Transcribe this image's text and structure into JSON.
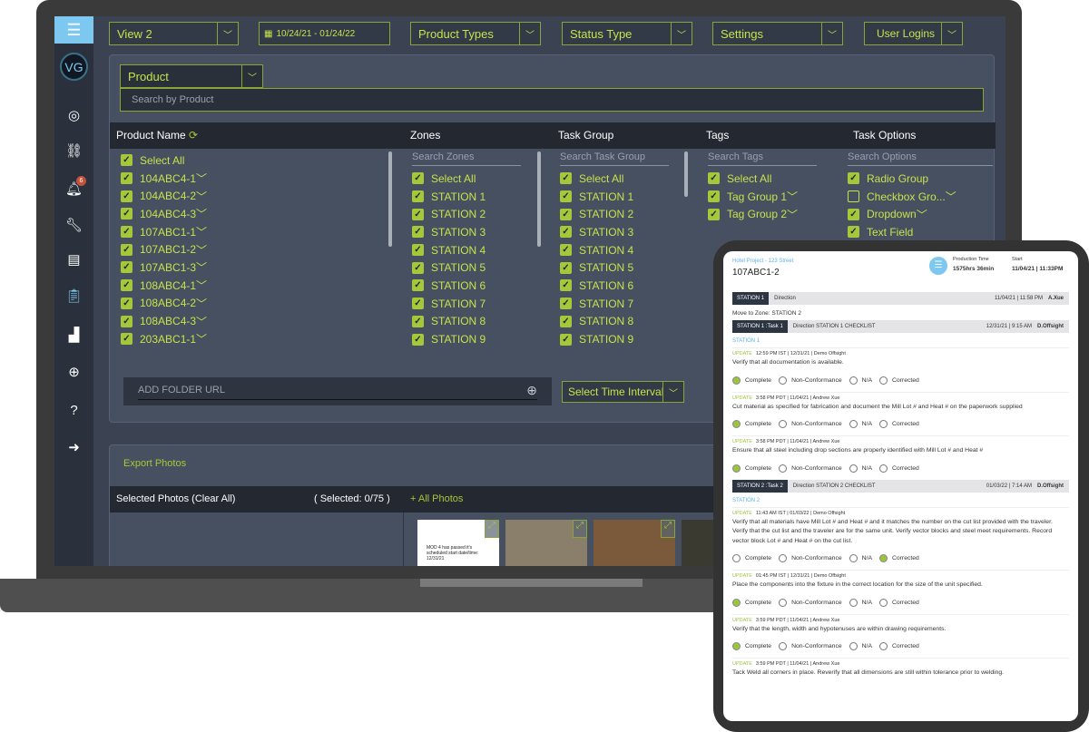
{
  "sidebar": {
    "logo_icon": "stack-logo-icon",
    "avatar": "VG",
    "notification_count": "6",
    "icons": [
      "target-icon",
      "broken-link-icon",
      "bell-icon",
      "wrench-icon",
      "list-icon",
      "clipboard-icon",
      "chart-icon",
      "grid-icon",
      "help-icon",
      "logout-icon"
    ]
  },
  "topbar": {
    "view": "View 2",
    "date_range": "10/24/21 - 01/24/22",
    "product_types": "Product Types",
    "status_type": "Status Type",
    "settings": "Settings",
    "user_logins": "User Logins"
  },
  "filter": {
    "product_dropdown": "Product",
    "search_placeholder": "Search by Product",
    "headers": {
      "product": "Product Name",
      "zones": "Zones",
      "task_group": "Task Group",
      "tags": "Tags",
      "task_options": "Task Options"
    },
    "search_zones": "Search Zones",
    "search_task_group": "Search Task Group",
    "search_tags": "Search Tags",
    "search_options": "Search Options",
    "products": [
      "Select All",
      "104ABC4-1",
      "104ABC4-2",
      "104ABC4-3",
      "107ABC1-1",
      "107ABC1-2",
      "107ABC1-3",
      "108ABC4-1",
      "108ABC4-2",
      "108ABC4-3",
      "203ABC1-1"
    ],
    "zones": [
      "Select All",
      "STATION 1",
      "STATION 2",
      "STATION 3",
      "STATION 4",
      "STATION 5",
      "STATION 6",
      "STATION 7",
      "STATION 8",
      "STATION 9"
    ],
    "task_groups": [
      "Select All",
      "STATION 1",
      "STATION 2",
      "STATION 3",
      "STATION 4",
      "STATION 5",
      "STATION 6",
      "STATION 7",
      "STATION 8",
      "STATION 9"
    ],
    "tags": [
      "Select All",
      "Tag Group 1",
      "Tag Group 2"
    ],
    "task_options": [
      {
        "label": "Radio Group",
        "checked": true
      },
      {
        "label": "Checkbox Gro...",
        "checked": false
      },
      {
        "label": "Dropdown",
        "checked": true
      },
      {
        "label": "Text Field",
        "checked": true
      }
    ],
    "folder_url_placeholder": "ADD FOLDER URL",
    "time_interval": "Select Time Interval"
  },
  "photos": {
    "export": "Export Photos",
    "selected_label": "Selected Photos (Clear All)",
    "selected_count": "( Selected: 0/75 )",
    "all_photos": "+ All Photos",
    "thumb_text": "MOD 4 has passed it's scheduled start date/time: 12/31/21"
  },
  "tablet": {
    "project": "Hotel Project - 123 Street",
    "product": "107ABC1-2",
    "production_time_label": "Production Time",
    "production_time": "1575hrs 36min",
    "start_label": "Start",
    "start": "11/04/21 | 11:33PM",
    "station_bar": {
      "tag": "STATION 1",
      "dir": "Direction",
      "date": "11/04/21 | 11:58 PM",
      "user": "A.Xue"
    },
    "move_to_zone": "Move to Zone:  STATION 2",
    "options": [
      "Complete",
      "Non-Conformance",
      "N/A",
      "Corrected"
    ],
    "tasks": [
      {
        "tag": "STATION 1 :Task 1",
        "dir": "Direction STATION 1 CHECKLIST",
        "date": "12/31/21 | 9:15 AM",
        "user": "D.Offsight",
        "station": "STATION 1",
        "updates": [
          {
            "meta": "12:59 PM IST | 12/31/21 | Demo Offsight",
            "text": "Verify that all documentation is available.",
            "selected": 0
          },
          {
            "meta": "3:58 PM PDT | 11/04/21 | Andrew Xue",
            "text": "Cut material as specified for fabrication and document the Mill Lot # and Heat # on the paperwork supplied",
            "selected": 0
          },
          {
            "meta": "3:58 PM PDT | 11/04/21 | Andrew Xue",
            "text": "Ensure that all steel including drop sections are properly identified with Mill Lot # and Heat #",
            "selected": 0
          }
        ]
      },
      {
        "tag": "STATION 2 :Task 2",
        "dir": "Direction STATION 2 CHECKLIST",
        "date": "01/03/22 | 7:14 AM",
        "user": "D.Offsight",
        "station": "STATION 2",
        "updates": [
          {
            "meta": "11:43 AM IST | 01/03/22 | Demo Offsight",
            "text": "Verify that all materials have Mill Lot # and Heat # and it matches the number on the cut list provided with the traveler. Verify that the cut list and the traveler are for the same unit. Verify vector blocks and steel meet requirements. Record vector block Lot # and Heat # on the cut list.",
            "selected": 3
          },
          {
            "meta": "01:45 PM IST | 12/31/21 | Demo Offsight",
            "text": "Place the components into the fixture in the correct location for the size of the unit specified.",
            "selected": 0
          },
          {
            "meta": "3:59 PM PDT | 11/04/21 | Andrew Xue",
            "text": "Verify that the length, width and hypotenuses are within drawing requirements.",
            "selected": 0
          },
          {
            "meta": "3:59 PM PDT | 11/04/21 | Andrew Xue",
            "text": "Tack Weld all corners in place. Reverify that all dimensions are still within tolerance prior to welding.",
            "selected": -1
          }
        ]
      }
    ],
    "update_label": "UPDATE"
  },
  "colors": {
    "accent": "#c7e24b",
    "sidebar": "#2a313c",
    "logo": "#7cc8f0",
    "complete": "#9bc53d"
  }
}
